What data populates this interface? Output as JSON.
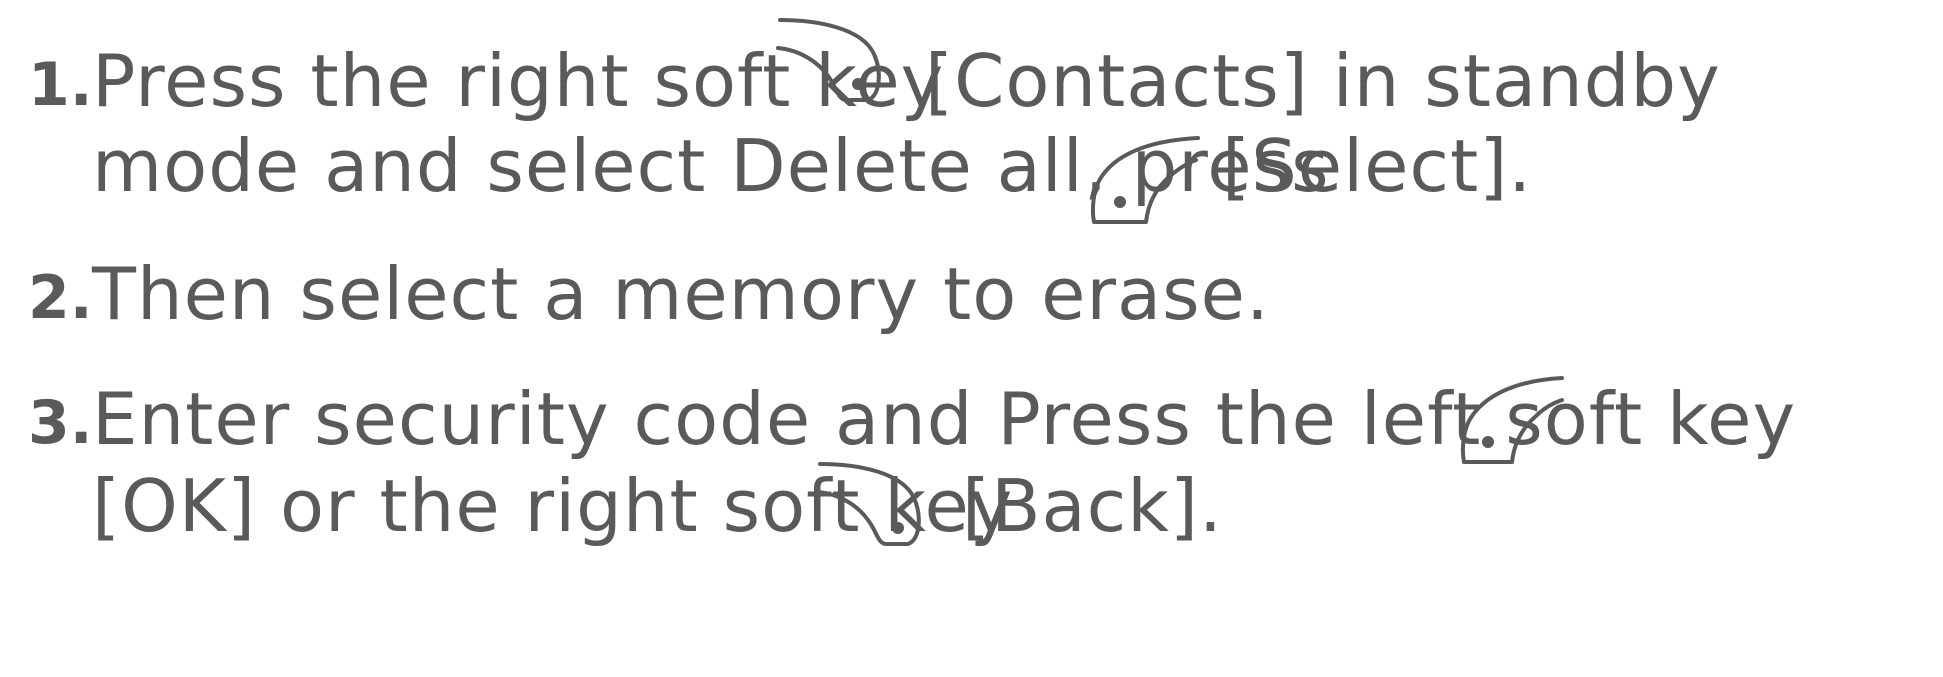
{
  "steps": [
    {
      "number": "1.",
      "line1_before": "Press the right soft key",
      "line1_after": "[Contacts] in standby",
      "line2_before": "mode and select Delete all, press",
      "line2_after": "[Select]."
    },
    {
      "number": "2.",
      "line1_before": "Then select a memory to erase."
    },
    {
      "number": "3.",
      "line1_before": "Enter security code and Press the left soft key",
      "line2_before": "[OK] or the right soft key",
      "line2_after": "[Back]."
    }
  ],
  "icons": {
    "right_soft_key": "right-soft-key-icon",
    "left_soft_key": "left-soft-key-icon"
  },
  "colors": {
    "text": "#5a5a5a",
    "background": "#ffffff"
  }
}
